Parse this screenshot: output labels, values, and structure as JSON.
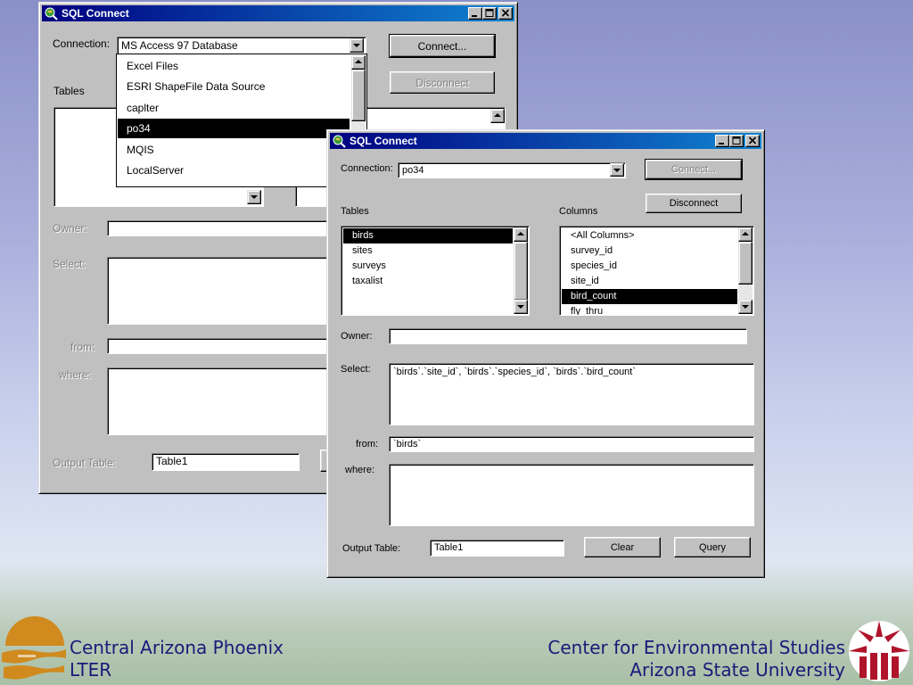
{
  "back_window": {
    "title": "SQL Connect",
    "connection_label": "Connection:",
    "connection_value": "MS Access 97 Database",
    "connect_label": "Connect...",
    "disconnect_label": "Disconnect",
    "tables_label": "Tables",
    "owner_label": "Owner:",
    "select_label": "Select:",
    "from_label": "from:",
    "where_label": "where:",
    "output_table_label": "Output Table:",
    "output_table_value": "Table1",
    "dropdown_options": [
      "Excel Files",
      "ESRI ShapeFile Data Source",
      "caplter",
      "po34",
      "MQIS",
      "LocalServer"
    ],
    "dropdown_selected": "po34"
  },
  "front_window": {
    "title": "SQL Connect",
    "connection_label": "Connection:",
    "connection_value": "po34",
    "connect_label": "Connect...",
    "disconnect_label": "Disconnect",
    "tables_label": "Tables",
    "columns_label": "Columns",
    "tables": [
      "birds",
      "sites",
      "surveys",
      "taxalist"
    ],
    "tables_selected": "birds",
    "columns": [
      "<All Columns>",
      "survey_id",
      "species_id",
      "site_id",
      "bird_count",
      "fly_thru"
    ],
    "columns_selected": "bird_count",
    "owner_label": "Owner:",
    "owner_value": "",
    "select_label": "Select:",
    "select_value": "`birds`.`site_id`, `birds`.`species_id`, `birds`.`bird_count`",
    "from_label": "from:",
    "from_value": "`birds`",
    "where_label": "where:",
    "where_value": "",
    "output_table_label": "Output Table:",
    "output_table_value": "Table1",
    "clear_label": "Clear",
    "query_label": "Query"
  },
  "footer": {
    "left_line1": "Central Arizona Phoenix",
    "left_line2": "LTER",
    "right_line1": "Center for Environmental Studies",
    "right_line2": "Arizona State University"
  },
  "colors": {
    "title_bar": "#000080",
    "footer_text": "#1a1a7a",
    "left_logo": "#d08a1e",
    "right_logo": "#b0142a"
  }
}
